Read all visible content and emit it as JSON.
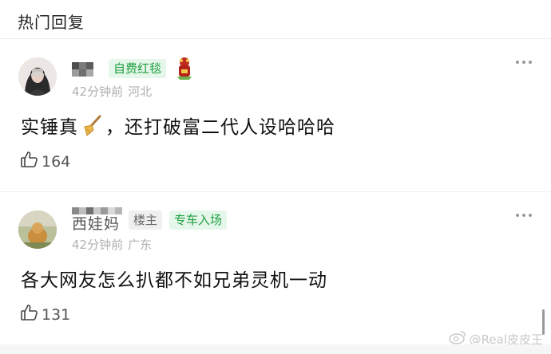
{
  "section": {
    "title": "热门回复"
  },
  "comments": [
    {
      "name_partial": "",
      "badges": [
        "自费红毯"
      ],
      "time": "42分钟前",
      "location": "河北",
      "text": "实锤真",
      "text_after_icon": "，还打破富二代人设哈哈哈",
      "likes": "164"
    },
    {
      "name_partial": "西娃妈",
      "badges": [
        "楼主",
        "专车入场"
      ],
      "time": "42分钟前",
      "location": "广东",
      "text": "各大网友怎么扒都不如兄弟灵机一动",
      "likes": "131"
    }
  ],
  "watermark": {
    "text": "@Real皮皮王"
  },
  "colors": {
    "badge_green": "#1f9f3f",
    "badge_green_bg": "#e5f7ea",
    "meta_gray": "#b0b0b0",
    "text": "#111111"
  },
  "icons": [
    "more-icon",
    "thumbs-up-icon",
    "broom-emoji",
    "weibo-icon"
  ]
}
